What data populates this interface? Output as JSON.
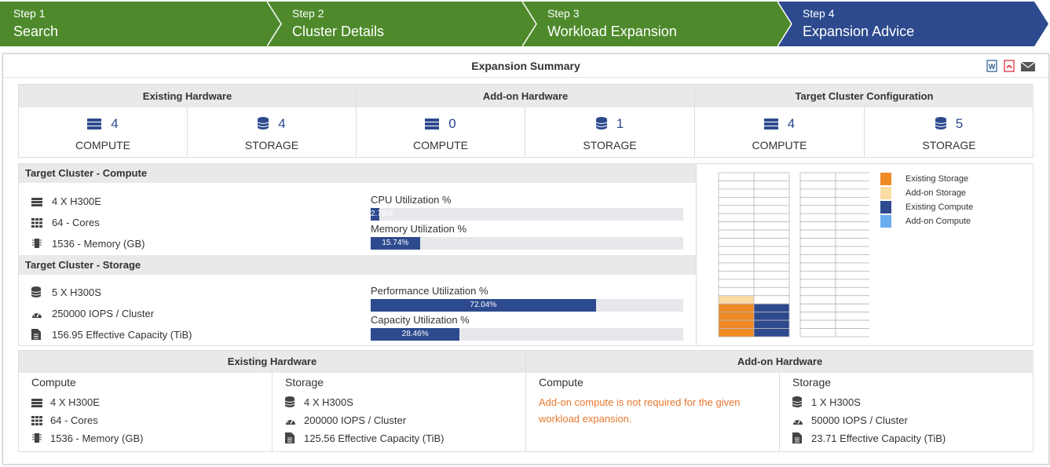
{
  "steps": [
    {
      "num": "Step 1",
      "name": "Search",
      "color": "#4e8a2b"
    },
    {
      "num": "Step 2",
      "name": "Cluster Details",
      "color": "#4e8a2b"
    },
    {
      "num": "Step 3",
      "name": "Workload Expansion",
      "color": "#4e8a2b"
    },
    {
      "num": "Step 4",
      "name": "Expansion Advice",
      "color": "#2d4a8e"
    }
  ],
  "panel": {
    "title": "Expansion Summary",
    "icons": [
      "word-icon",
      "pdf-icon",
      "email-icon"
    ]
  },
  "summary": {
    "groups": [
      {
        "title": "Existing Hardware",
        "compute": "4",
        "storage": "4"
      },
      {
        "title": "Add-on Hardware",
        "compute": "0",
        "storage": "1"
      },
      {
        "title": "Target Cluster Configuration",
        "compute": "4",
        "storage": "5"
      }
    ],
    "compute_label": "COMPUTE",
    "storage_label": "STORAGE"
  },
  "target_compute": {
    "title": "Target Cluster - Compute",
    "items": [
      "4 X H300E",
      "64 - Cores",
      "1536 - Memory (GB)"
    ],
    "metrics": [
      {
        "label": "CPU Utilization %",
        "value": 2.79,
        "text": "2.79%"
      },
      {
        "label": "Memory Utilization %",
        "value": 15.74,
        "text": "15.74%"
      }
    ]
  },
  "target_storage": {
    "title": "Target Cluster - Storage",
    "items": [
      "5 X H300S",
      "250000 IOPS / Cluster",
      "156.95 Effective Capacity (TiB)"
    ],
    "metrics": [
      {
        "label": "Performance Utilization %",
        "value": 72.04,
        "text": "72.04%"
      },
      {
        "label": "Capacity Utilization %",
        "value": 28.46,
        "text": "28.46%"
      }
    ]
  },
  "rack": {
    "existing_storage": 4,
    "addon_storage": 1,
    "existing_compute": 4,
    "addon_compute": 0,
    "units_per_rack": 20
  },
  "legend": [
    {
      "label": "Existing Storage",
      "color": "#f08a24"
    },
    {
      "label": "Add-on Storage",
      "color": "#fbdca4"
    },
    {
      "label": "Existing Compute",
      "color": "#2d4a8e"
    },
    {
      "label": "Add-on Compute",
      "color": "#6aaef0"
    }
  ],
  "bottom": {
    "existing_title": "Existing Hardware",
    "addon_title": "Add-on Hardware",
    "existing_compute": {
      "title": "Compute",
      "lines": [
        "4 X H300E",
        "64 - Cores",
        "1536 - Memory (GB)"
      ]
    },
    "existing_storage": {
      "title": "Storage",
      "lines": [
        "4 X H300S",
        "200000 IOPS / Cluster",
        "125.56 Effective Capacity (TiB)"
      ]
    },
    "addon_compute": {
      "title": "Compute",
      "note": "Add-on compute is not required for the given workload expansion."
    },
    "addon_storage": {
      "title": "Storage",
      "lines": [
        "1 X H300S",
        "50000 IOPS / Cluster",
        "23.71 Effective Capacity (TiB)"
      ]
    }
  }
}
